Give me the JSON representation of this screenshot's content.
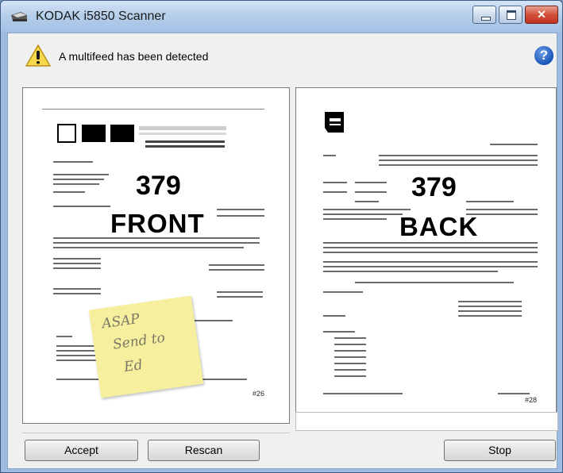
{
  "window": {
    "title": "KODAK i5850 Scanner",
    "controls": {
      "minimize": "minimize",
      "maximize": "maximize",
      "close": "✕"
    }
  },
  "message": "A multifeed has been detected",
  "help_symbol": "?",
  "front": {
    "number": "379",
    "label": "FRONT",
    "page_number": "#26"
  },
  "back": {
    "number": "379",
    "label": "BACK",
    "page_number": "#28"
  },
  "sticky_note": {
    "lines": [
      "ASAP",
      "Send to",
      "Ed"
    ]
  },
  "buttons": {
    "accept": "Accept",
    "rescan": "Rescan",
    "stop": "Stop"
  },
  "colors": {
    "title_bar": "#b3cde9",
    "close_button": "#d2503a",
    "warning": "#f7d84a",
    "help": "#1a55b8",
    "sticky_note": "#f5ef9e"
  },
  "icons": [
    "scanner-icon",
    "warning-icon",
    "help-icon"
  ]
}
